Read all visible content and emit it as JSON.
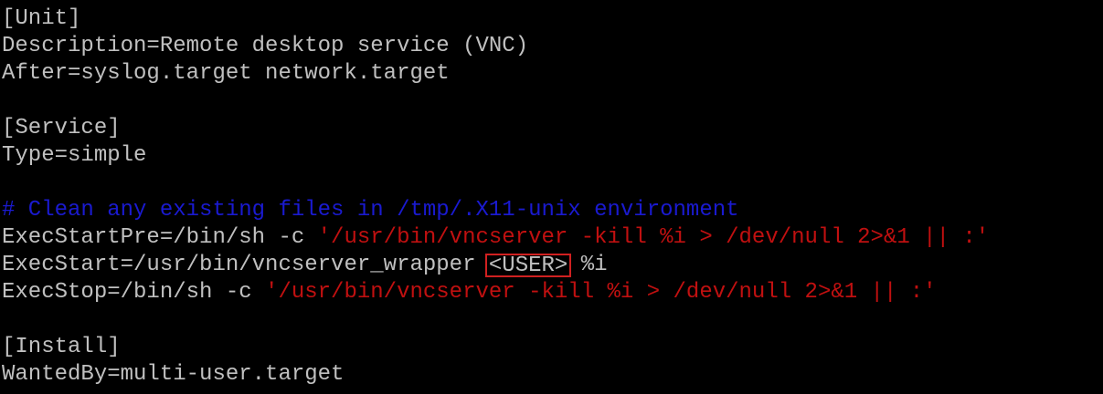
{
  "colors": {
    "background": "#000000",
    "text": "#c0c0c0",
    "comment": "#1a1ad0",
    "string": "#c01010",
    "highlight_box": "#d02020"
  },
  "unit": {
    "header": "[Unit]",
    "description": "Description=Remote desktop service (VNC)",
    "after": "After=syslog.target network.target"
  },
  "service": {
    "header": "[Service]",
    "type": "Type=simple",
    "comment": "# Clean any existing files in /tmp/.X11-unix environment",
    "exec_start_pre_prefix": "ExecStartPre=/bin/sh -c ",
    "exec_start_pre_arg": "'/usr/bin/vncserver -kill %i > /dev/null 2>&1 || :'",
    "exec_start_prefix": "ExecStart=/usr/bin/vncserver_wrapper ",
    "exec_start_user": "<USER>",
    "exec_start_suffix": " %i",
    "exec_stop_prefix": "ExecStop=/bin/sh -c ",
    "exec_stop_arg": "'/usr/bin/vncserver -kill %i > /dev/null 2>&1 || :'"
  },
  "install": {
    "header": "[Install]",
    "wanted_by": "WantedBy=multi-user.target"
  }
}
